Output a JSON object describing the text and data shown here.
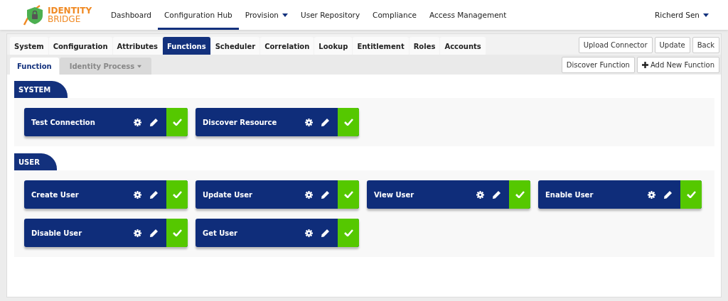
{
  "logo": {
    "line_1": "IDENTITY",
    "line_2": "BRIDGE"
  },
  "nav": [
    {
      "label": "Dashboard",
      "selected": false,
      "dropdown": false
    },
    {
      "label": "Configuration Hub",
      "selected": true,
      "dropdown": false
    },
    {
      "label": "Provision",
      "selected": false,
      "dropdown": true
    },
    {
      "label": "User Repository",
      "selected": false,
      "dropdown": false
    },
    {
      "label": "Compliance",
      "selected": false,
      "dropdown": false
    },
    {
      "label": "Access Management",
      "selected": false,
      "dropdown": false
    }
  ],
  "user_menu": {
    "label": "Richerd Sen"
  },
  "tabs": [
    {
      "label": "System",
      "selected": false
    },
    {
      "label": "Configuration",
      "selected": false
    },
    {
      "label": "Attributes",
      "selected": false
    },
    {
      "label": "Functions",
      "selected": true
    },
    {
      "label": "Scheduler",
      "selected": false
    },
    {
      "label": "Correlation",
      "selected": false
    },
    {
      "label": "Lookup",
      "selected": false
    },
    {
      "label": "Entitlement",
      "selected": false
    },
    {
      "label": "Roles",
      "selected": false
    },
    {
      "label": "Accounts",
      "selected": false
    }
  ],
  "tab_buttons": [
    "Upload Connector",
    "Update",
    "Back"
  ],
  "subtabs": [
    {
      "label": "Function",
      "selected": true,
      "dropdown": false
    },
    {
      "label": "Identity Process",
      "selected": false,
      "dropdown": true
    }
  ],
  "subtab_buttons": [
    {
      "label": "Discover Function",
      "kind": "plain"
    },
    {
      "label": "Add New Function",
      "kind": "add"
    }
  ],
  "sections": [
    {
      "title": "SYSTEM",
      "functions": [
        {
          "name": "Test Connection",
          "enabled": true
        },
        {
          "name": "Discover Resource",
          "enabled": true
        }
      ]
    },
    {
      "title": "USER",
      "functions": [
        {
          "name": "Create User",
          "enabled": true
        },
        {
          "name": "Update User",
          "enabled": true
        },
        {
          "name": "View User",
          "enabled": true
        },
        {
          "name": "Enable User",
          "enabled": true
        },
        {
          "name": "Disable User",
          "enabled": true
        },
        {
          "name": "Get User",
          "enabled": true
        }
      ]
    }
  ]
}
